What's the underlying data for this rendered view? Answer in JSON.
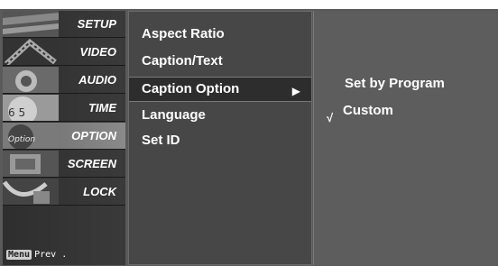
{
  "sidebar": {
    "categories": [
      {
        "label": "SETUP"
      },
      {
        "label": "VIDEO"
      },
      {
        "label": "AUDIO"
      },
      {
        "label": "TIME"
      },
      {
        "label": "OPTION"
      },
      {
        "label": "SCREEN"
      },
      {
        "label": "LOCK"
      }
    ],
    "option_art_text": "Option",
    "time_art_digits": "6 5",
    "menu_key": "Menu",
    "menu_hint": "Prev ."
  },
  "submenu": {
    "items": [
      {
        "label": "Aspect Ratio"
      },
      {
        "label": "Caption/Text"
      },
      {
        "label": "Caption Option",
        "selected": true
      },
      {
        "label": "Language"
      },
      {
        "label": "Set ID"
      }
    ],
    "arrow": "▶"
  },
  "options": {
    "items": [
      {
        "label": "Set by Program"
      },
      {
        "label": "Custom",
        "checked": true
      }
    ],
    "check_glyph": "√"
  },
  "colors": {
    "osd_background": "#5a5a5a",
    "highlight": "#2d2d2d",
    "text": "#ffffff"
  }
}
